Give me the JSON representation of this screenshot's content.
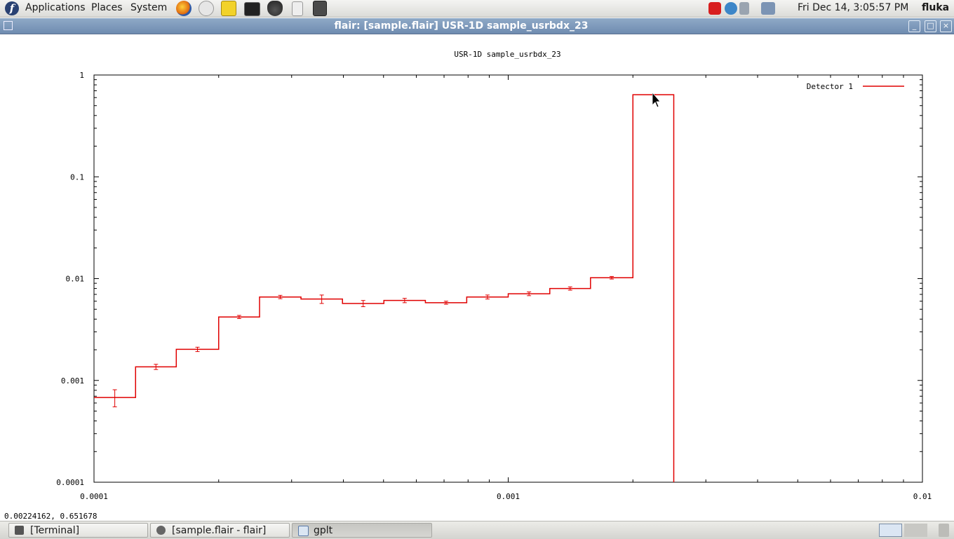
{
  "top_panel": {
    "menus": [
      "Applications",
      "Places",
      "System"
    ],
    "launchers": [
      "firefox-icon",
      "mail-clock-icon",
      "notes-icon",
      "terminal-icon",
      "cauldron-icon",
      "device-icon",
      "calculator-icon"
    ],
    "tray": [
      "alert-icon",
      "update-icon",
      "volume-icon",
      "network-icon"
    ],
    "clock": "Fri Dec 14,  3:05:57 PM",
    "user": "fluka"
  },
  "window": {
    "title": "flair: [sample.flair] USR-1D sample_usrbdx_23",
    "buttons": {
      "minimize": "_",
      "maximize": "□",
      "close": "×"
    }
  },
  "plot": {
    "coordinate_readout": "0.00224162,  0.651678"
  },
  "chart_data": {
    "type": "line",
    "title": "USR-1D sample_usrbdx_23",
    "xlabel": "",
    "ylabel": "",
    "x_scale": "log",
    "y_scale": "log",
    "xlim": [
      0.0001,
      0.01
    ],
    "ylim": [
      0.0001,
      1
    ],
    "x_tick_labels": [
      "0.0001",
      "0.001",
      "0.01"
    ],
    "y_tick_labels": [
      "1",
      "0.1",
      "0.01",
      "0.001",
      "0.0001"
    ],
    "legend_position": "top-right",
    "grid": false,
    "step_style": "histogram",
    "series": [
      {
        "name": "Detector 1",
        "color": "#e00000",
        "bin_edges": [
          0.0001,
          0.000126,
          0.000158,
          0.0002,
          0.000251,
          0.000316,
          0.000398,
          0.000501,
          0.000631,
          0.000794,
          0.001,
          0.00126,
          0.00158,
          0.002,
          0.00251
        ],
        "values": [
          0.00068,
          0.00136,
          0.00202,
          0.0042,
          0.0066,
          0.0063,
          0.0057,
          0.0061,
          0.0058,
          0.0066,
          0.0071,
          0.008,
          0.0102,
          0.64
        ],
        "errors": [
          0.00013,
          8e-05,
          0.0001,
          0.00015,
          0.00025,
          0.0006,
          0.0004,
          0.0003,
          0.0002,
          0.0003,
          0.0003,
          0.0003,
          0.0003,
          0.005
        ]
      }
    ]
  }
}
